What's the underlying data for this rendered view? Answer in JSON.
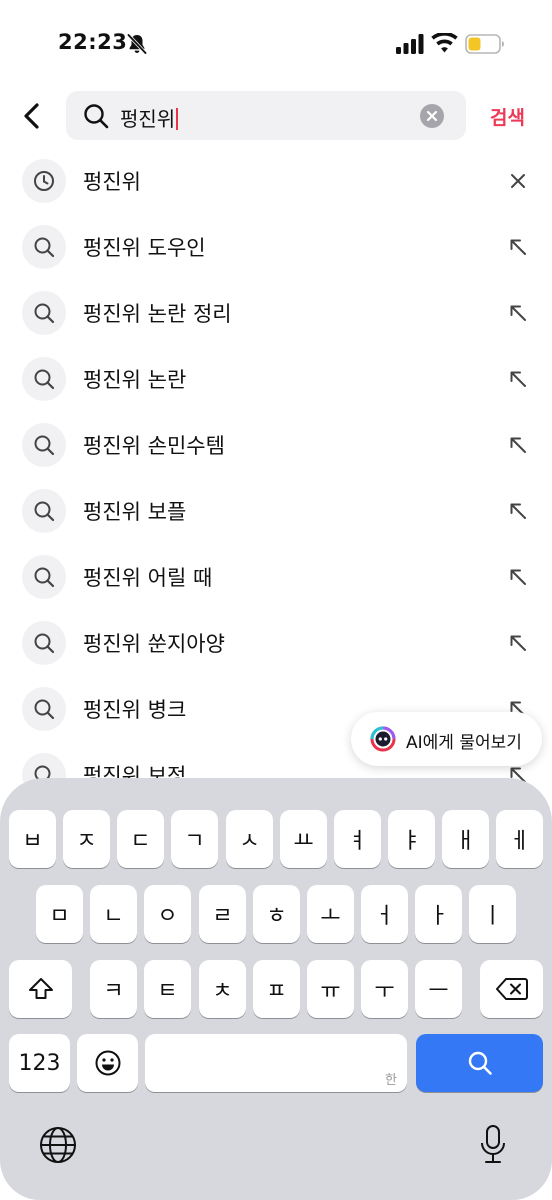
{
  "status_bar": {
    "time": "22:23",
    "icons": [
      "bell-slash-icon",
      "cellular-signal-icon",
      "wifi-icon",
      "battery-low-icon"
    ],
    "battery_color": "#f3c625"
  },
  "search": {
    "query": "펑진위",
    "submit_label": "검색",
    "accent_color": "#ec3a57"
  },
  "suggestions": [
    {
      "text": "펑진위",
      "type": "history",
      "left_icon": "clock-icon",
      "right_icon": "remove-x-icon"
    },
    {
      "text": "펑진위 도우인",
      "type": "suggest",
      "left_icon": "search-icon",
      "right_icon": "fill-arrow-icon"
    },
    {
      "text": "펑진위 논란 정리",
      "type": "suggest",
      "left_icon": "search-icon",
      "right_icon": "fill-arrow-icon"
    },
    {
      "text": "펑진위 논란",
      "type": "suggest",
      "left_icon": "search-icon",
      "right_icon": "fill-arrow-icon"
    },
    {
      "text": "펑진위 손민수템",
      "type": "suggest",
      "left_icon": "search-icon",
      "right_icon": "fill-arrow-icon"
    },
    {
      "text": "펑진위 보플",
      "type": "suggest",
      "left_icon": "search-icon",
      "right_icon": "fill-arrow-icon"
    },
    {
      "text": "펑진위 어릴 때",
      "type": "suggest",
      "left_icon": "search-icon",
      "right_icon": "fill-arrow-icon"
    },
    {
      "text": "펑진위 쑨지아양",
      "type": "suggest",
      "left_icon": "search-icon",
      "right_icon": "fill-arrow-icon"
    },
    {
      "text": "펑진위 병크",
      "type": "suggest",
      "left_icon": "search-icon",
      "right_icon": "fill-arrow-icon"
    },
    {
      "text": "펑진위 보정",
      "type": "suggest",
      "left_icon": "search-icon",
      "right_icon": "fill-arrow-icon"
    }
  ],
  "ai_button": {
    "label": "AI에게 물어보기",
    "icon": "ai-assistant-icon"
  },
  "keyboard": {
    "row1": [
      "ㅂ",
      "ㅈ",
      "ㄷ",
      "ㄱ",
      "ㅅ",
      "ㅛ",
      "ㅕ",
      "ㅑ",
      "ㅐ",
      "ㅔ"
    ],
    "row2": [
      "ㅁ",
      "ㄴ",
      "ㅇ",
      "ㄹ",
      "ㅎ",
      "ㅗ",
      "ㅓ",
      "ㅏ",
      "ㅣ"
    ],
    "row3": [
      "ㅋ",
      "ㅌ",
      "ㅊ",
      "ㅍ",
      "ㅠ",
      "ㅜ",
      "ㅡ"
    ],
    "numbers_label": "123",
    "space_hint": "한",
    "search_key_color": "#3478f6",
    "icons": [
      "shift-icon",
      "backspace-icon",
      "emoji-icon",
      "search-icon",
      "globe-icon",
      "microphone-icon"
    ]
  }
}
